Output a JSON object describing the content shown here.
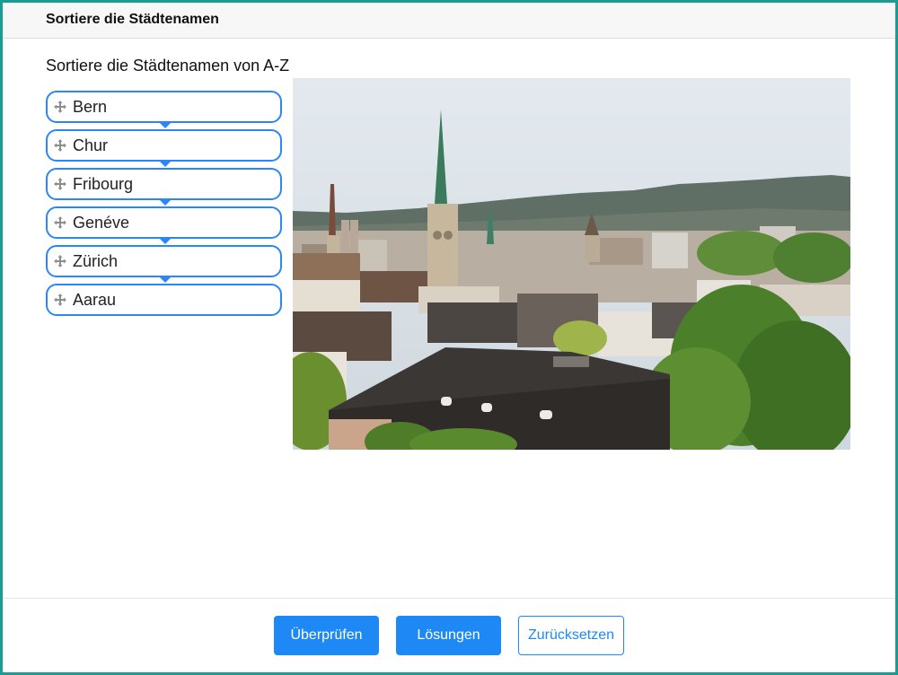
{
  "header": {
    "title": "Sortiere die Städtenamen"
  },
  "task": {
    "instruction": "Sortiere die Städtenamen von A-Z"
  },
  "items": [
    {
      "label": "Bern"
    },
    {
      "label": "Chur"
    },
    {
      "label": "Fribourg"
    },
    {
      "label": "Genéve"
    },
    {
      "label": "Zürich"
    },
    {
      "label": "Aarau"
    }
  ],
  "image": {
    "subject": "Zürich city view"
  },
  "buttons": {
    "check": "Überprüfen",
    "solutions": "Lösungen",
    "reset": "Zurücksetzen"
  },
  "colors": {
    "accent": "#1e88f5",
    "frame": "#1a9c95",
    "header_bg": "#f7f7f7"
  }
}
